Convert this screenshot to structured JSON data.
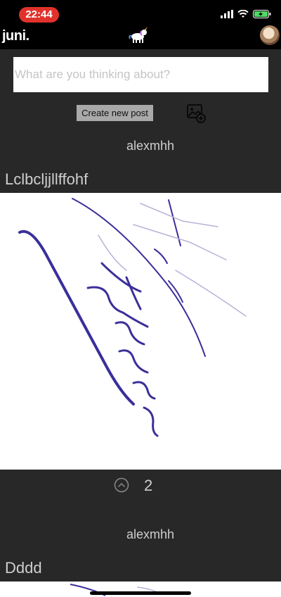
{
  "status_bar": {
    "time": "22:44",
    "icons": [
      "signal-icon",
      "wifi-icon",
      "battery-charging-icon"
    ]
  },
  "header": {
    "brand": "juni.",
    "mascot": "unicorn-icon",
    "avatar": "profile-avatar"
  },
  "composer": {
    "placeholder": "What are you thinking about?",
    "create_label": "Create new post",
    "image_icon": "add-image-icon"
  },
  "posts": [
    {
      "author": "alexmhh",
      "text": "Lclbcljjllffohf",
      "image": "handwritten-signature",
      "votes": "2"
    },
    {
      "author": "alexmhh",
      "text": "Dddd",
      "image": "handwritten-signature"
    }
  ],
  "colors": {
    "background": "#282828",
    "bar": "#000000",
    "time_pill": "#e0322b",
    "button": "#a9a9a9",
    "ink": "#3a2f9a"
  }
}
